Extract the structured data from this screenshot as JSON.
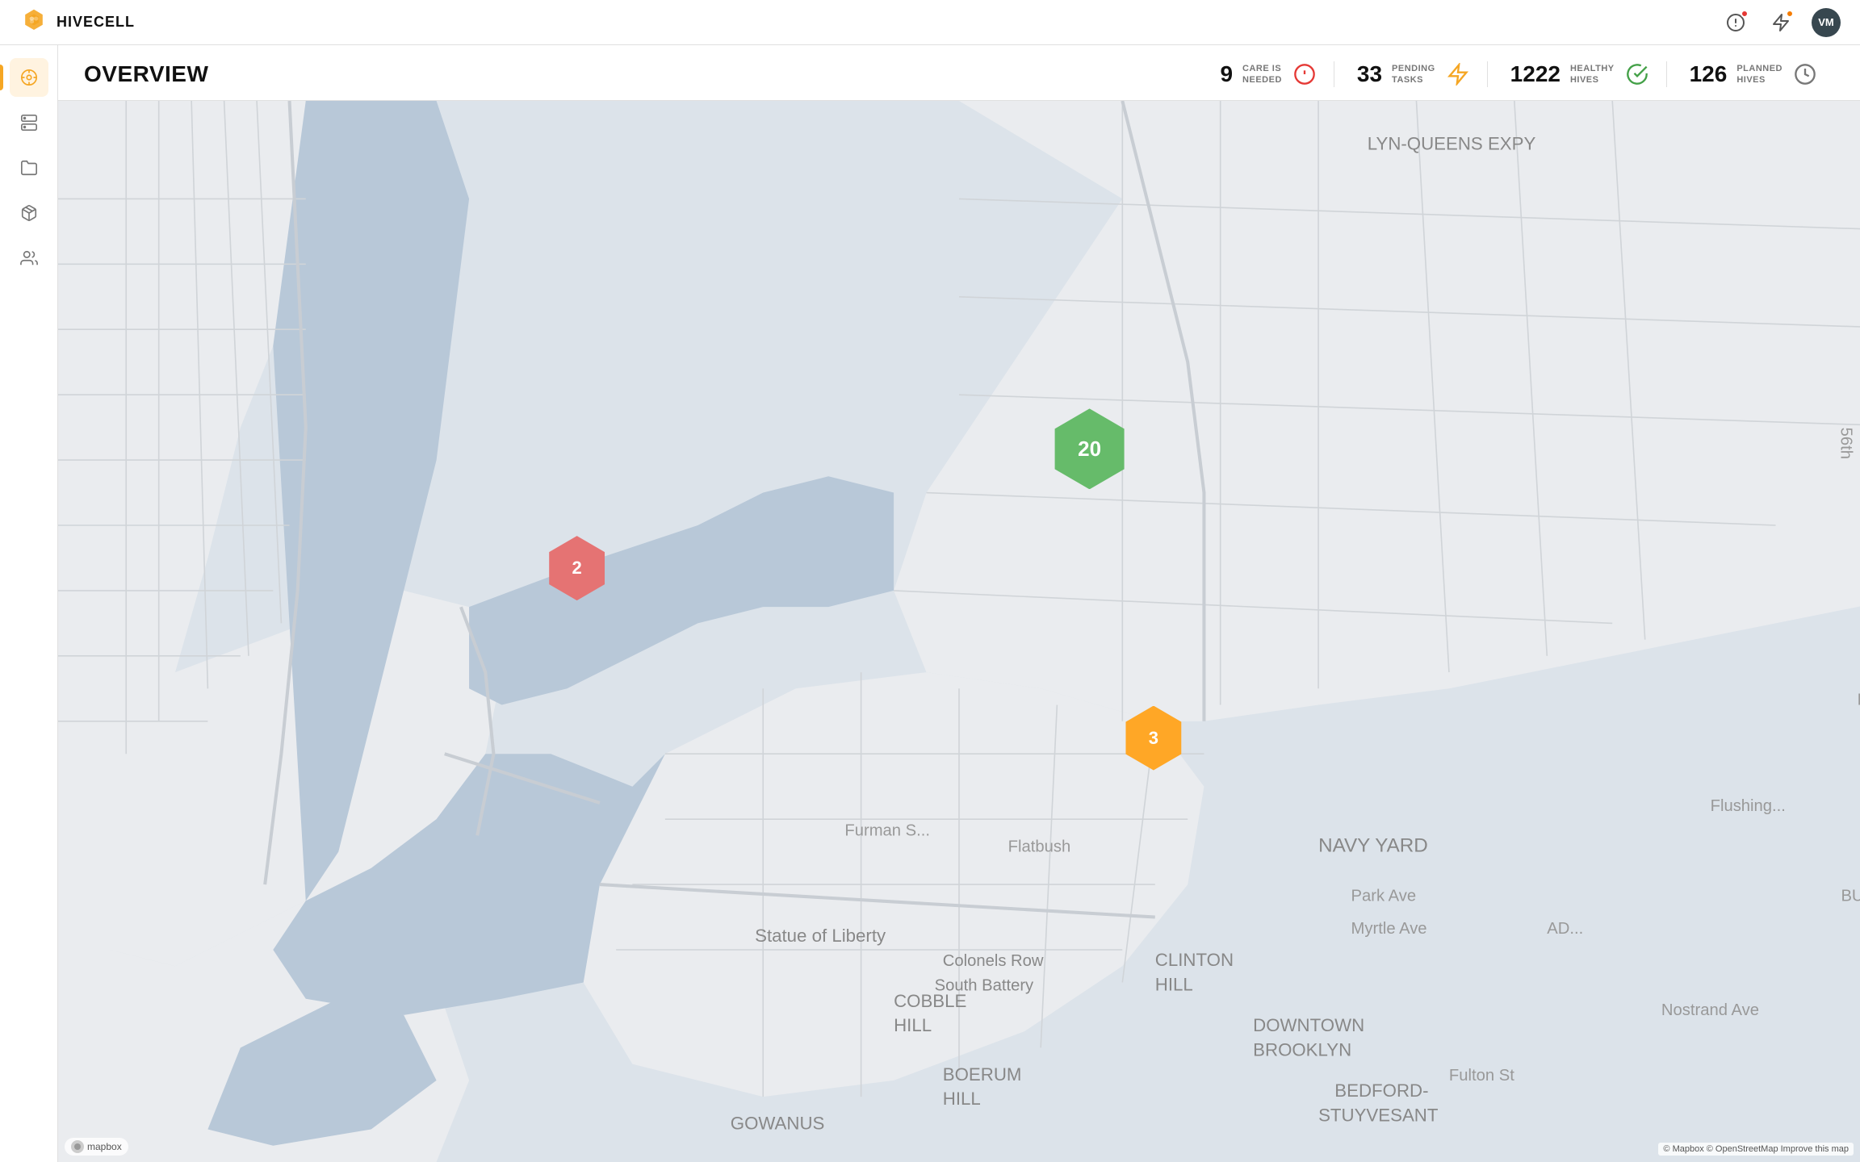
{
  "header": {
    "logo_text": "HIVECELL",
    "alert_badge_color": "#e53935",
    "lightning_badge_color": "#f57c00",
    "avatar_initials": "VM"
  },
  "sidebar": {
    "items": [
      {
        "id": "dashboard",
        "icon": "dashboard-icon",
        "active": true
      },
      {
        "id": "servers",
        "icon": "server-icon",
        "active": false
      },
      {
        "id": "folder",
        "icon": "folder-icon",
        "active": false
      },
      {
        "id": "packages",
        "icon": "package-icon",
        "active": false
      },
      {
        "id": "users",
        "icon": "users-icon",
        "active": false
      }
    ]
  },
  "page": {
    "title": "OVERVIEW",
    "stats": [
      {
        "id": "care-needed",
        "number": "9",
        "label_line1": "CARE IS",
        "label_line2": "NEEDED",
        "icon": "alert-circle-icon",
        "icon_color": "#e53935"
      },
      {
        "id": "pending-tasks",
        "number": "33",
        "label_line1": "PENDING",
        "label_line2": "TASKS",
        "icon": "lightning-icon",
        "icon_color": "#f5a623"
      },
      {
        "id": "healthy-hives",
        "number": "1222",
        "label_line1": "HEALTHY",
        "label_line2": "HIVES",
        "icon": "check-circle-icon",
        "icon_color": "#43a047"
      },
      {
        "id": "planned-hives",
        "number": "126",
        "label_line1": "PLANNED",
        "label_line2": "HIVES",
        "icon": "clock-icon",
        "icon_color": "#555"
      }
    ]
  },
  "map": {
    "clusters": [
      {
        "id": "cluster-red",
        "count": "2",
        "color": "#e57373",
        "left": "28%",
        "top": "43%"
      },
      {
        "id": "cluster-green",
        "count": "20",
        "color": "#66bb6a",
        "left": "56%",
        "top": "31%"
      },
      {
        "id": "cluster-orange",
        "count": "3",
        "color": "#ffa726",
        "left": "60%",
        "top": "59%"
      }
    ],
    "attribution": "© Mapbox © OpenStreetMap Improve this map",
    "mapbox_label": "mapbox"
  }
}
